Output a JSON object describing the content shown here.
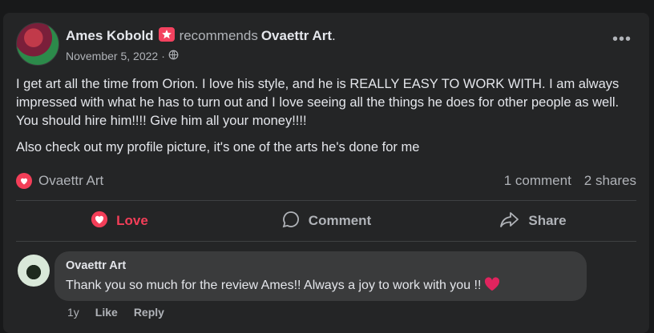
{
  "post": {
    "author": "Ames Kobold",
    "recommends": "recommends",
    "page": "Ovaettr Art",
    "period": ".",
    "date": "November 5, 2022",
    "dot": "·",
    "paragraph1": "I get art all the time from Orion.  I love his style, and he is REALLY EASY TO WORK WITH.  I am always impressed with what he has to turn out and I love seeing all the things he does for other people as well.  You should hire him!!!!  Give him all your money!!!!",
    "paragraph2": "Also check out my profile picture, it's one of the arts he's done for me",
    "reaction_name": "Ovaettr Art",
    "comments_count": "1 comment",
    "shares_count": "2 shares"
  },
  "actions": {
    "love": "Love",
    "comment": "Comment",
    "share": "Share"
  },
  "comment": {
    "author": "Ovaettr Art",
    "text": "Thank you so much for the review Ames!! Always a joy to work with you !!",
    "time": "1y",
    "like": "Like",
    "reply": "Reply"
  },
  "colors": {
    "background": "#18191a",
    "card": "#242526",
    "love": "#f33e58",
    "muted": "#b0b3b8"
  }
}
